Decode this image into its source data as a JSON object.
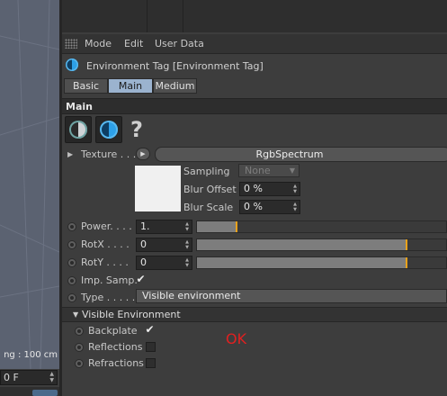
{
  "viewport": {
    "grid_spacing_text": "ng : 100 cm",
    "frame_field_value": "0 F"
  },
  "menu": {
    "items": [
      "Mode",
      "Edit",
      "User Data"
    ]
  },
  "title": {
    "text": "Environment Tag [Environment Tag]"
  },
  "tabs": [
    {
      "label": "Basic",
      "active": false
    },
    {
      "label": "Main",
      "active": true
    },
    {
      "label": "Medium",
      "active": false
    }
  ],
  "main_section": {
    "title": "Main",
    "help_icon_text": "?",
    "texture": {
      "label": "Texture . . .",
      "shader_name": "RgbSpectrum",
      "sampling_label": "Sampling",
      "sampling_value": "None",
      "blur_offset_label": "Blur Offset",
      "blur_offset_value": "0 %",
      "blur_scale_label": "Blur Scale",
      "blur_scale_value": "0 %"
    },
    "power": {
      "label": "Power. . . .",
      "value": "1.",
      "slider_fraction": 0.16
    },
    "rotx": {
      "label": "RotX . . . .",
      "value": "0",
      "slider_fraction": 0.84
    },
    "roty": {
      "label": "RotY . . . .",
      "value": "0",
      "slider_fraction": 0.84
    },
    "imp_samp": {
      "label": "Imp. Samp.",
      "checked": true,
      "check_glyph": "✔"
    },
    "type": {
      "label": "Type . . . . .",
      "value": "Visible environment"
    }
  },
  "visible_section": {
    "title": "Visible Environment",
    "backplate": {
      "label": "Backplate",
      "checked": true,
      "check_glyph": "✔"
    },
    "reflections": {
      "label": "Reflections",
      "checked": false
    },
    "refractions": {
      "label": "Refractions",
      "checked": false
    }
  },
  "annotation": {
    "text": "OK",
    "color": "#e02020"
  },
  "colors": {
    "accent_tab": "#9bb3cf",
    "slider_handle": "#e8a11b",
    "panel_bg": "#3d3d3d",
    "viewport_bg": "#5b6271"
  }
}
